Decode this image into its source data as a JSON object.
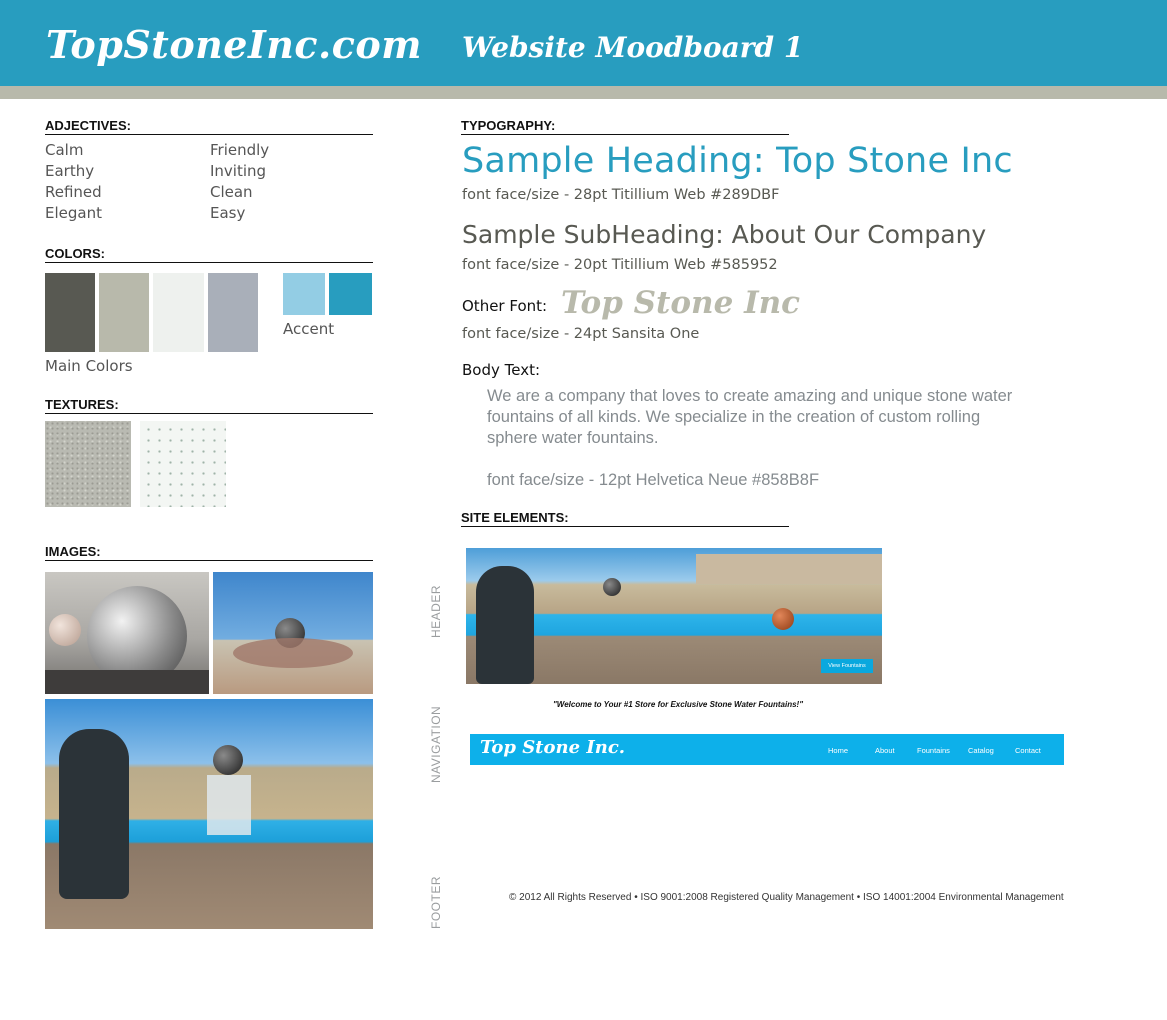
{
  "banner": {
    "site_name": "TopStoneInc.com",
    "board_title": "Website Moodboard 1"
  },
  "adjectives": {
    "heading": "ADJECTIVES:",
    "col1": [
      "Calm",
      "Earthy",
      "Refined",
      "Elegant"
    ],
    "col2": [
      "Friendly",
      "Inviting",
      "Clean",
      "Easy"
    ]
  },
  "colors": {
    "heading": "COLORS:",
    "main": [
      "#585952",
      "#b8b9ab",
      "#eef1ee",
      "#a9afb9"
    ],
    "accent": [
      "#93cde4",
      "#289dbf"
    ],
    "main_label": "Main Colors",
    "accent_label": "Accent"
  },
  "textures": {
    "heading": "TEXTURES:"
  },
  "images": {
    "heading": "IMAGES:"
  },
  "typography": {
    "heading": "TYPOGRAPHY:",
    "sample_heading": "Sample Heading: Top Stone Inc",
    "heading_spec": "font face/size - 28pt Titillium Web #289DBF",
    "sample_subheading": "Sample SubHeading: About Our Company",
    "subheading_spec": "font face/size - 20pt Titillium Web #585952",
    "other_label": "Other Font:",
    "other_sample": "Top Stone Inc",
    "other_spec": "font face/size - 24pt Sansita One",
    "body_label": "Body Text:",
    "body_sample": "We are a company that loves to create amazing and unique stone water fountains of all kinds. We specialize in the creation of custom rolling sphere water fountains.",
    "body_spec": "font face/size - 12pt Helvetica Neue #858B8F"
  },
  "site_elements": {
    "heading": "SITE ELEMENTS:",
    "header_label": "HEADER",
    "navigation_label": "NAVIGATION",
    "footer_label": "FOOTER",
    "view_button": "View Fountains",
    "tagline": "\"Welcome to Your #1 Store for Exclusive Stone Water Fountains!\"",
    "nav_brand": "Top Stone Inc.",
    "nav_links": [
      "Home",
      "About",
      "Fountains",
      "Catalog",
      "Contact"
    ],
    "footer_text": "© 2012 All Rights Reserved • ISO 9001:2008 Registered Quality Management • ISO 14001:2004 Environmental Management"
  }
}
